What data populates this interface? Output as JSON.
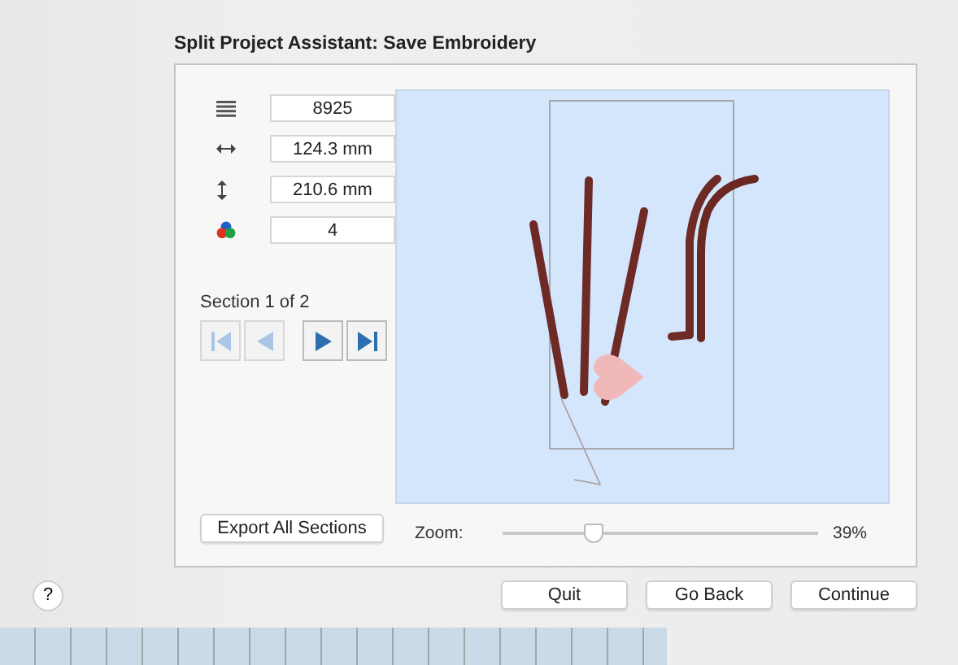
{
  "window": {
    "title": "Split Project Assistant: Save Embroidery"
  },
  "stats": [
    {
      "kind": "stitches",
      "value": "8925"
    },
    {
      "kind": "width",
      "value": "124.3 mm"
    },
    {
      "kind": "height",
      "value": "210.6 mm"
    },
    {
      "kind": "colors",
      "value": "4"
    }
  ],
  "section": {
    "label": "Section 1 of 2"
  },
  "nav_buttons": [
    {
      "kind": "first",
      "disabled": true
    },
    {
      "kind": "prev",
      "disabled": true
    },
    {
      "kind": "next",
      "disabled": false
    },
    {
      "kind": "last",
      "disabled": false
    }
  ],
  "export_button": "Export All Sections",
  "zoom": {
    "label": "Zoom:",
    "level": 0.29,
    "reading": "39%"
  },
  "help_button": "?",
  "buttons": [
    "Quit",
    "Go Back",
    "Continue"
  ]
}
